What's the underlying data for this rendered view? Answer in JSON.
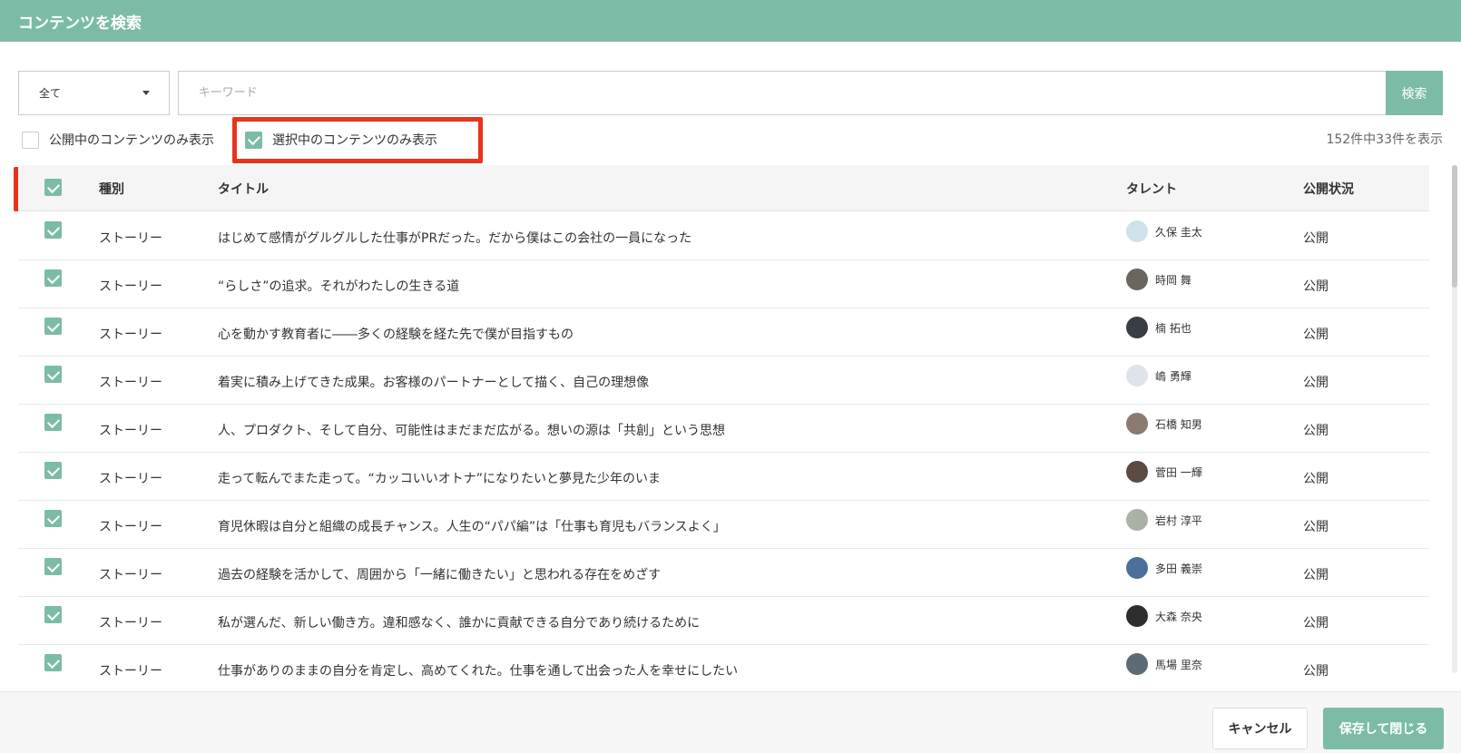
{
  "header": {
    "title": "コンテンツを検索"
  },
  "search": {
    "type_select_value": "全て",
    "keyword_placeholder": "キーワード",
    "keyword_value": "",
    "search_button_label": "検索"
  },
  "filters": {
    "public_only": {
      "label": "公開中のコンテンツのみ表示",
      "checked": false
    },
    "selected_only": {
      "label": "選択中のコンテンツのみ表示",
      "checked": true
    }
  },
  "result_count": "152件中33件を表示",
  "table": {
    "select_all_checked": true,
    "columns": {
      "type": "種別",
      "title": "タイトル",
      "talent": "タレント",
      "status": "公開状況"
    },
    "rows": [
      {
        "checked": true,
        "type": "ストーリー",
        "title": "はじめて感情がグルグルした仕事がPRだった。だから僕はこの会社の一員になった",
        "talent": "久保 圭太",
        "status": "公開",
        "avatar_color": "#cfe2ea"
      },
      {
        "checked": true,
        "type": "ストーリー",
        "title": "“らしさ”の追求。それがわたしの生きる道",
        "talent": "時岡 舞",
        "status": "公開",
        "avatar_color": "#6b6560"
      },
      {
        "checked": true,
        "type": "ストーリー",
        "title": "心を動かす教育者に――多くの経験を経た先で僕が目指すもの",
        "talent": "楠 拓也",
        "status": "公開",
        "avatar_color": "#3a3d44"
      },
      {
        "checked": true,
        "type": "ストーリー",
        "title": "着実に積み上げてきた成果。お客様のパートナーとして描く、自己の理想像",
        "talent": "嶋 勇輝",
        "status": "公開",
        "avatar_color": "#dfe3ea"
      },
      {
        "checked": true,
        "type": "ストーリー",
        "title": "人、プロダクト、そして自分、可能性はまだまだ広がる。想いの源は「共創」という思想",
        "talent": "石橋 知男",
        "status": "公開",
        "avatar_color": "#8a7a70"
      },
      {
        "checked": true,
        "type": "ストーリー",
        "title": "走って転んでまた走って。“カッコいいオトナ”になりたいと夢見た少年のいま",
        "talent": "菅田 一輝",
        "status": "公開",
        "avatar_color": "#5a4a42"
      },
      {
        "checked": true,
        "type": "ストーリー",
        "title": "育児休暇は自分と組織の成長チャンス。人生の“パパ編”は「仕事も育児もバランスよく」",
        "talent": "岩村 淳平",
        "status": "公開",
        "avatar_color": "#a9b2a4"
      },
      {
        "checked": true,
        "type": "ストーリー",
        "title": "過去の経験を活かして、周囲から「一緒に働きたい」と思われる存在をめざす",
        "talent": "多田 義崇",
        "status": "公開",
        "avatar_color": "#4a6f9a"
      },
      {
        "checked": true,
        "type": "ストーリー",
        "title": "私が選んだ、新しい働き方。違和感なく、誰かに貢献できる自分であり続けるために",
        "talent": "大森 奈央",
        "status": "公開",
        "avatar_color": "#2e2e2e"
      },
      {
        "checked": true,
        "type": "ストーリー",
        "title": "仕事がありのままの自分を肯定し、高めてくれた。仕事を通して出会った人を幸せにしたい",
        "talent": "馬場 里奈",
        "status": "公開",
        "avatar_color": "#5c6b74"
      }
    ]
  },
  "footer": {
    "cancel_label": "キャンセル",
    "save_label": "保存して閉じる"
  },
  "colors": {
    "accent": "#7cbca6",
    "highlight": "#e8341c"
  }
}
